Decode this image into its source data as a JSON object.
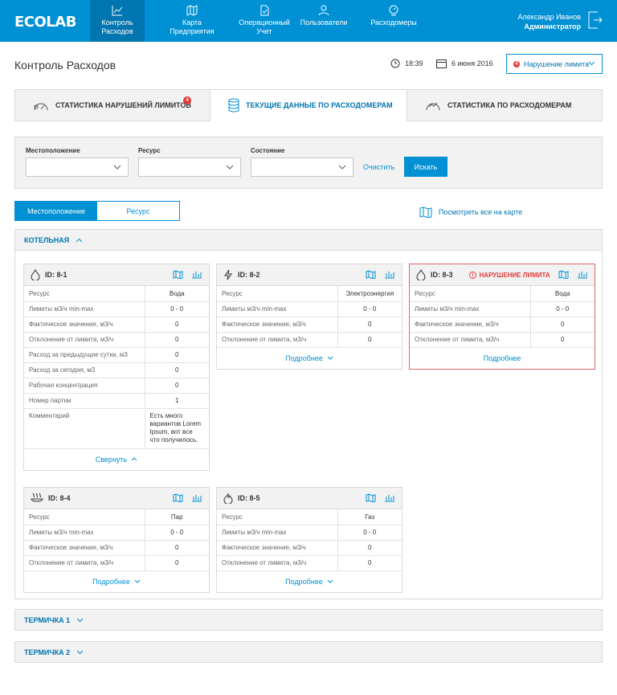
{
  "header": {
    "logo": "ECOLAB",
    "nav": [
      {
        "label": "Контроль Расходов",
        "icon": "chart-line-icon",
        "active": true
      },
      {
        "label": "Карта Предприятия",
        "icon": "map-icon",
        "active": false
      },
      {
        "label": "Операционный Учет",
        "icon": "document-icon",
        "active": false
      },
      {
        "label": "Пользователи",
        "icon": "user-icon",
        "active": false
      },
      {
        "label": "Расходомеры",
        "icon": "meter-icon",
        "active": false
      }
    ],
    "user_name": "Александр Иванов",
    "user_role": "Администратор"
  },
  "page": {
    "title": "Контроль Расходов",
    "time": "18:39",
    "date": "6 июня 2016",
    "limit_filter": "Нарушение лимита",
    "limit_badge": "4"
  },
  "tabs": [
    {
      "label": "СТАТИСТИКА НАРУШЕНИЙ ЛИМИТОВ",
      "badge": "4"
    },
    {
      "label": "ТЕКУЩИЕ ДАННЫЕ ПО РАСХОДОМЕРАМ"
    },
    {
      "label": "СТАТИСТИКА ПО РАСХОДОМЕРАМ"
    }
  ],
  "filter": {
    "location_label": "Местоположение",
    "resource_label": "Ресурс",
    "state_label": "Состояние",
    "clear": "Очистить",
    "search": "Искать"
  },
  "toggle": {
    "location": "Местоположение",
    "resource": "Ресурс"
  },
  "map_link": "Посмотреть все на карте",
  "sections": [
    {
      "title": "КОТЕЛЬНАЯ"
    },
    {
      "title": "ТЕРМИЧКА 1"
    },
    {
      "title": "ТЕРМИЧКА 2"
    }
  ],
  "cards": [
    {
      "id": "ID: 8-1",
      "icon": "water-drop-icon",
      "rows": [
        [
          "Ресурс",
          "Вода"
        ],
        [
          "Лимиты м3/ч min-max",
          "0 - 0"
        ],
        [
          "Фактическое значение, м3/ч",
          "0"
        ],
        [
          "Отклонение от лимита, м3/ч",
          "0"
        ],
        [
          "Расход за предыдущие сутки, м3",
          "0"
        ],
        [
          "Расход за сегодня, м3",
          "0"
        ],
        [
          "Рабочая концентрация",
          "0"
        ],
        [
          "Номер партии",
          "1"
        ],
        [
          "Комментарий",
          "Есть много вариантов Lorem Ipsum, вот все что получилось."
        ]
      ],
      "footer": "Свернуть"
    },
    {
      "id": "ID: 8-2",
      "icon": "lightning-icon",
      "rows": [
        [
          "Ресурс",
          "Электроэнергия"
        ],
        [
          "Лимиты м3/ч min-max",
          "0 - 0"
        ],
        [
          "Фактическое значение, м3/ч",
          "0"
        ],
        [
          "Отклонение от лимита, м3/ч",
          "0"
        ]
      ],
      "footer": "Подробнее"
    },
    {
      "id": "ID: 8-3",
      "icon": "water-drop-icon",
      "violation": "НАРУШЕНИЕ ЛИМИТА",
      "rows": [
        [
          "Ресурс",
          "Вода"
        ],
        [
          "Лимиты м3/ч min-max",
          "0 - 0"
        ],
        [
          "Фактическое значение, м3/ч",
          "0"
        ],
        [
          "Отклонение от лимита, м3/ч",
          "0"
        ]
      ],
      "footer": "Подробнее"
    },
    {
      "id": "ID: 8-4",
      "icon": "steam-icon",
      "rows": [
        [
          "Ресурс",
          "Пар"
        ],
        [
          "Лимиты м3/ч min-max",
          "0 - 0"
        ],
        [
          "Фактическое значение, м3/ч",
          "0"
        ],
        [
          "Отклонение от лимита, м3/ч",
          "0"
        ]
      ],
      "footer": "Подробнее"
    },
    {
      "id": "ID: 8-5",
      "icon": "flame-icon",
      "rows": [
        [
          "Ресурс",
          "Газ"
        ],
        [
          "Лимиты м3/ч min-max",
          "0 - 0"
        ],
        [
          "Фактическое значение, м3/ч",
          "0"
        ],
        [
          "Отклонение от лимита, м3/ч",
          "0"
        ]
      ],
      "footer": "Подробнее"
    }
  ],
  "colors": {
    "primary": "#0090d4",
    "primary_dark": "#0075b0",
    "alert": "#e23a3a"
  }
}
